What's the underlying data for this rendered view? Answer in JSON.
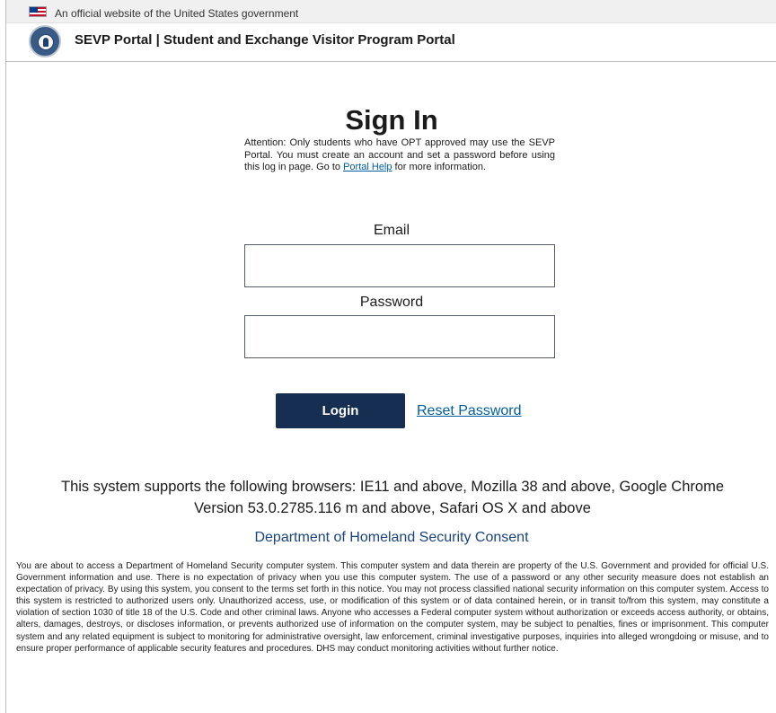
{
  "banner": {
    "text": "An official website of the United States government"
  },
  "header": {
    "title": "SEVP Portal | Student and Exchange Visitor Program Portal"
  },
  "signin": {
    "title": "Sign In",
    "attention_before": "Attention: Only students who have OPT approved may use the SEVP Portal. You must create an account and set a password before using this log in page. Go to ",
    "help_link": "Portal Help",
    "attention_after": " for more information."
  },
  "form": {
    "email_label": "Email",
    "email_value": "",
    "password_label": "Password",
    "password_value": "",
    "login_label": "Login",
    "reset_label": "Reset Password"
  },
  "browsers_text": "This system supports the following browsers: IE11 and above, Mozilla 38 and above, Google Chrome Version 53.0.2785.116 m and above, Safari OS X and above",
  "consent": {
    "heading": "Department of Homeland Security Consent",
    "body": "You are about to access a Department of Homeland Security computer system. This computer system and data therein are property of the U.S. Government and provided for official U.S. Government information and use. There is no expectation of privacy when you use this computer system. The use of a password or any other security measure does not establish an expectation of privacy. By using this system, you consent to the terms set forth in this notice. You may not process classified national security information on this computer system. Access to this system is restricted to authorized users only. Unauthorized access, use, or modification of this system or of data contained herein, or in transit to/from this system, may constitute a violation of section 1030 of title 18 of the U.S. Code and other criminal laws. Anyone who accesses a Federal computer system without authorization or exceeds access authority, or obtains, alters, damages, destroys, or discloses information, or prevents authorized use of information on the computer system, may be subject to penalties, fines or imprisonment. This computer system and any related equipment is subject to monitoring for administrative oversight, law enforcement, criminal investigative purposes, inquiries into alleged wrongdoing or misuse, and to ensure proper performance of applicable security features and procedures. DHS may conduct monitoring activities without further notice."
  },
  "icons": {
    "flag": "us-flag-icon",
    "seal": "dhs-seal-icon"
  },
  "colors": {
    "primary_button": "#162e51",
    "link": "#005ea2",
    "consent_heading": "#1a4480"
  }
}
